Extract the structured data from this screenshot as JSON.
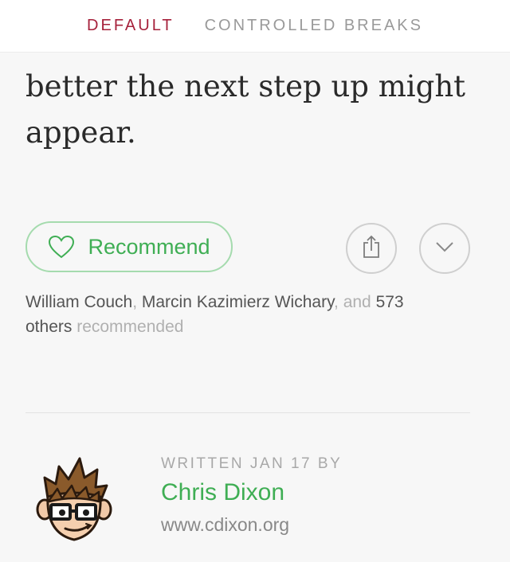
{
  "tabs": [
    {
      "label": "DEFAULT",
      "active": true
    },
    {
      "label": "CONTROLLED BREAKS",
      "active": false
    }
  ],
  "article": {
    "line1": "better the next step up might",
    "line2": "appear."
  },
  "actions": {
    "recommend_label": "Recommend",
    "share_icon": "share-icon",
    "more_icon": "chevron-down-icon"
  },
  "recommenders": {
    "name1": "William Couch",
    "sep1": ", ",
    "name2": "Marcin Kazimierz Wichary",
    "sep2": ", and ",
    "count": "573",
    "others": "others",
    "suffix": " recommended"
  },
  "author": {
    "written_label": "WRITTEN JAN 17 BY",
    "name": "Chris Dixon",
    "site": "www.cdixon.org"
  },
  "colors": {
    "accent_red": "#a6213b",
    "accent_green": "#3fae54",
    "border_green": "#a5dbae",
    "background": "#f7f7f7"
  }
}
